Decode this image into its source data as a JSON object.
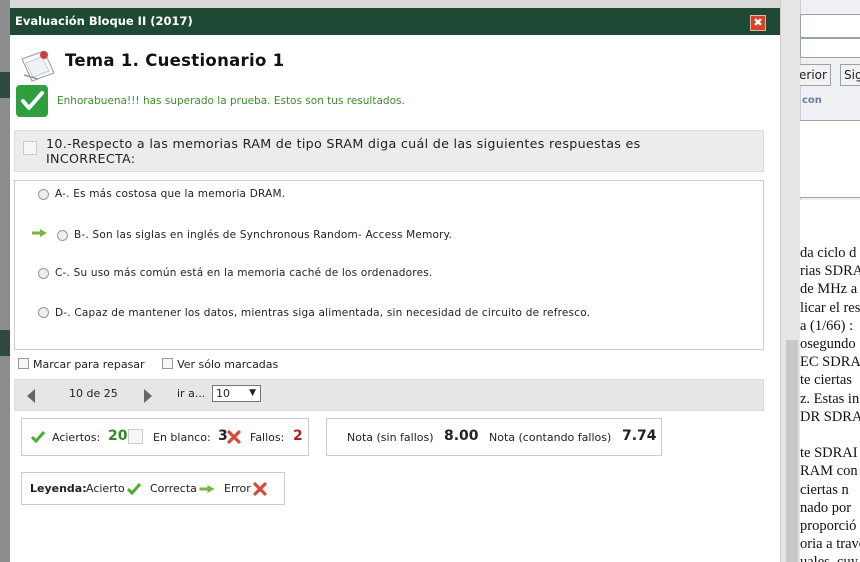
{
  "dialog": {
    "title": "Evaluación Bloque II (2017)",
    "close_label": "✖"
  },
  "quiz": {
    "title": "Tema 1. Cuestionario 1",
    "success_message": "Enhorabuena!!! has superado la prueba. Estos son tus resultados."
  },
  "question": {
    "text_line1": "10.-Respecto a las memorias RAM de tipo SRAM diga cuál de las siguientes respuestas es",
    "text_line2": "INCORRECTA:",
    "answers": [
      "A-. Es más costosa que la memoria DRAM.",
      "B-. Son las siglas en inglés de Synchronous Random- Access Memory.",
      "C-. Su uso más común está en la memoria caché de los ordenadores.",
      "D-. Capaz de mantener los datos, mientras siga alimentada, sin necesidad de circuito de refresco."
    ]
  },
  "marks": {
    "review_label": "Marcar para repasar",
    "only_marked_label": "Ver sólo marcadas"
  },
  "nav": {
    "position": "10 de 25",
    "goto_label": "ir a...",
    "goto_value": "10"
  },
  "results": {
    "correct_label": "Aciertos:",
    "correct_value": "20",
    "blank_label": "En blanco:",
    "blank_value": "3",
    "wrong_label": "Fallos:",
    "wrong_value": "2"
  },
  "grades": {
    "grade_no_penalty_label": "Nota (sin fallos)",
    "grade_no_penalty_value": "8.00",
    "grade_penalty_label": "Nota (contando fallos)",
    "grade_penalty_value": "7.74"
  },
  "legend": {
    "title": "Leyenda:",
    "correct": "Acierto",
    "right_answer": "Correcta",
    "error": "Error"
  },
  "background": {
    "btn_prev": "erior",
    "btn_next": "Sig",
    "con_label": "con",
    "text_lines": [
      "da ciclo d",
      "rias SDRA",
      "de MHz a",
      "licar el res",
      "a (1/66) :",
      "osegundo",
      "EC SDRA",
      "te ciertas",
      "z. Estas in",
      "DR SDRA",
      "",
      "te SDRAI",
      "RAM con",
      " ciertas n",
      "nado por",
      "proporció",
      "oria a travé",
      "uales, cuy"
    ]
  },
  "colors": {
    "titlebar": "#1e4a35",
    "success": "#3a8f2a",
    "correct_value": "#2e8b1f",
    "wrong_value": "#b02020"
  }
}
